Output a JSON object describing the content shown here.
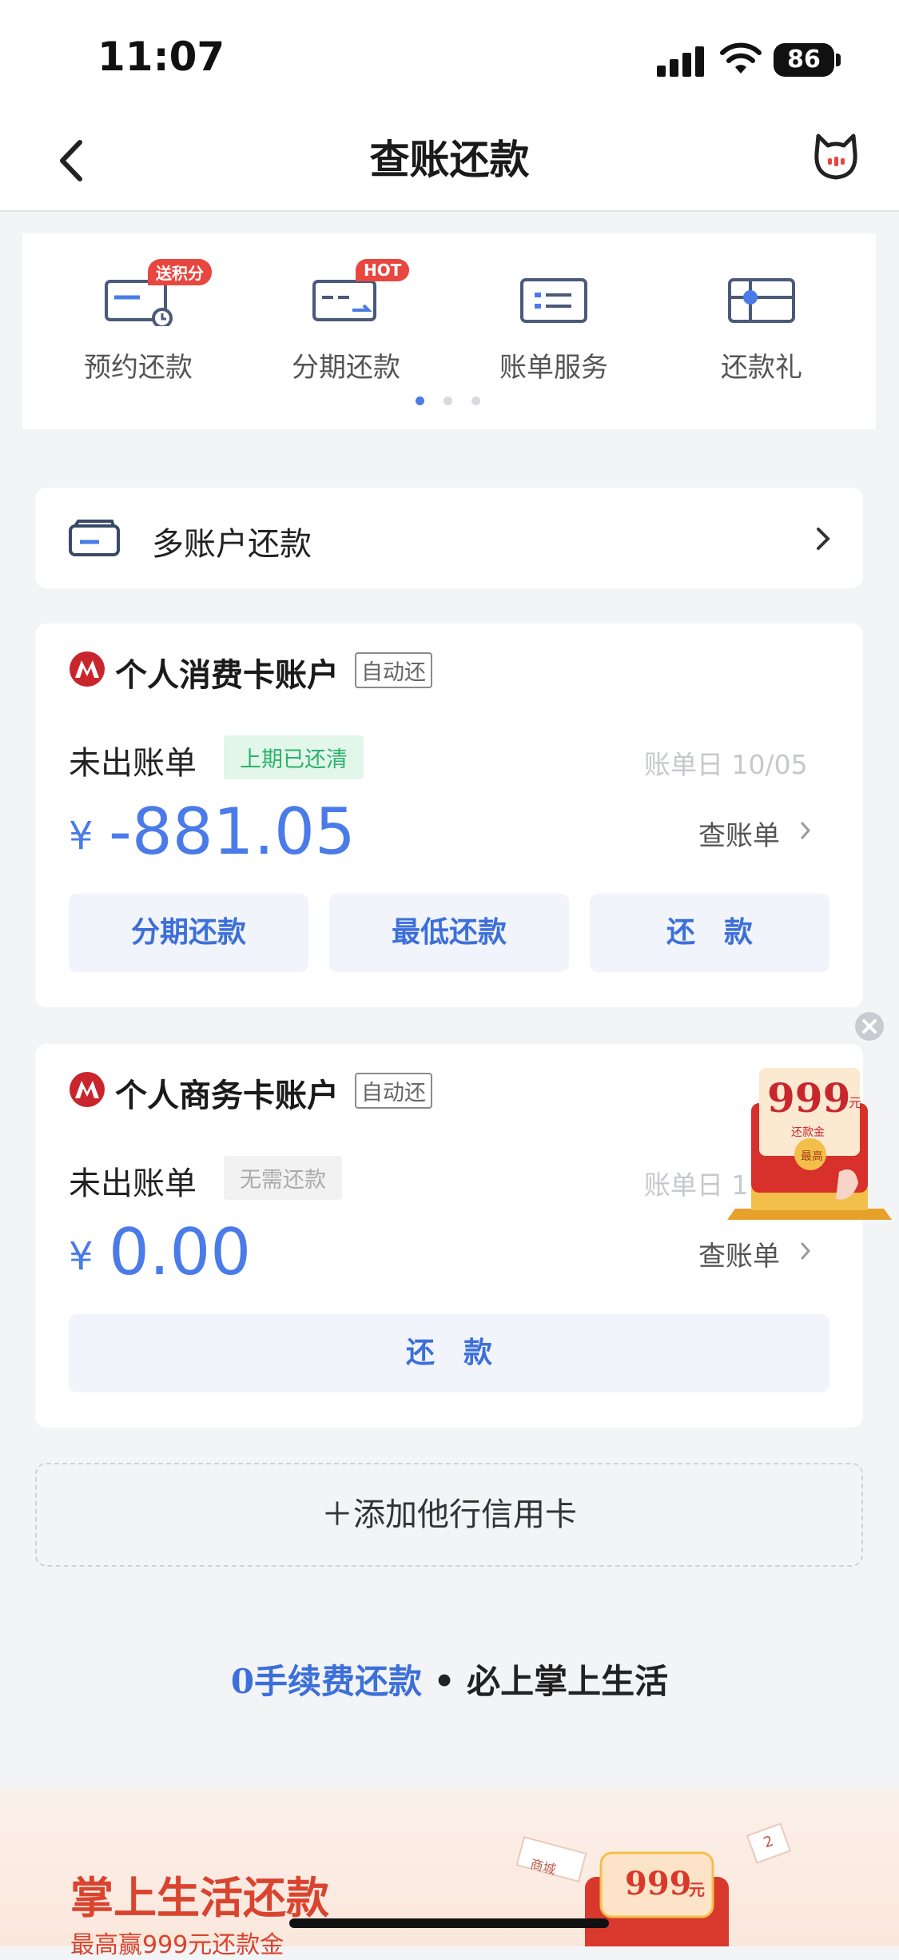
{
  "status_bar": {
    "time": "11:07",
    "battery": "86"
  },
  "header": {
    "title": "查账还款"
  },
  "quick_menu": {
    "items": [
      {
        "label": "预约还款",
        "badge": "送积分",
        "icon": "calendar-clock-card-icon"
      },
      {
        "label": "分期还款",
        "badge": "HOT",
        "icon": "installment-card-icon"
      },
      {
        "label": "账单服务",
        "badge": "",
        "icon": "bill-card-icon"
      },
      {
        "label": "还款礼",
        "badge": "",
        "icon": "gift-card-icon"
      }
    ],
    "page_count": 3,
    "active_page": 1
  },
  "multi_account": {
    "label": "多账户还款"
  },
  "accounts": [
    {
      "title": "个人消费卡账户",
      "auto_tag": "自动还",
      "status_label": "未出账单",
      "status_tag": "上期已还清",
      "bill_day": "账单日 10/05",
      "currency": "¥",
      "amount": "-881.05",
      "check_label": "查账单",
      "buttons": [
        "分期还款",
        "最低还款",
        "还　款"
      ]
    },
    {
      "title": "个人商务卡账户",
      "auto_tag": "自动还",
      "status_label": "未出账单",
      "status_tag": "无需还款",
      "bill_day": "账单日 1",
      "currency": "¥",
      "amount": "0.00",
      "check_label": "查账单",
      "buttons": [
        "还　款"
      ]
    }
  ],
  "add_card": {
    "label": "＋添加他行信用卡"
  },
  "promo_line": {
    "highlight": "0手续费还款",
    "rest": " • 必上掌上生活"
  },
  "floating_ad": {
    "amount": "999",
    "unit": "元",
    "caption": "还款金",
    "seal": "最高"
  },
  "banner": {
    "title": "掌上生活还款",
    "subtitle": "最高赢999元还款金",
    "badge_amount": "999",
    "badge_unit": "元",
    "tag1": "商城",
    "tag2": "2"
  },
  "colors": {
    "accent": "#4a7be8",
    "brand_red": "#d9442f",
    "tag_green": "#2bb36b"
  }
}
